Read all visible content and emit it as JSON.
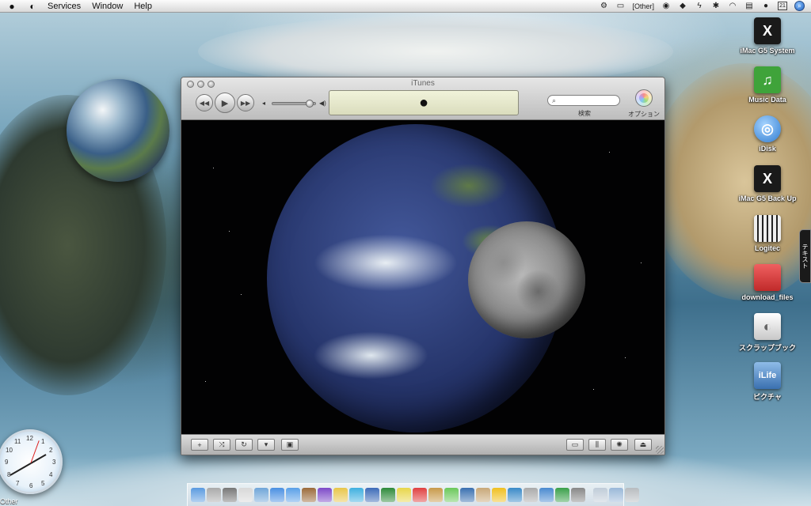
{
  "menubar": {
    "items": [
      "Services",
      "Window",
      "Help"
    ],
    "other_label": "[Other]",
    "calendar_day": "21"
  },
  "itunes": {
    "title": "iTunes",
    "search_label": "検索",
    "options_label": "オプション",
    "volume_level": 0.8
  },
  "desktop_icons": [
    {
      "label": "iMac G5 System",
      "icon": "x-drive-icon",
      "color": "#1a1a1a"
    },
    {
      "label": "Music Data",
      "icon": "music-folder-icon",
      "color": "#3fa33a"
    },
    {
      "label": "iDisk",
      "icon": "idisk-icon",
      "color": "#2f7bd0"
    },
    {
      "label": "iMac G5 Back Up",
      "icon": "x-drive-icon",
      "color": "#1a1a1a"
    },
    {
      "label": "Logitec",
      "icon": "logitec-drive-icon",
      "color": "#222222"
    },
    {
      "label": "download_files",
      "icon": "red-folder-icon",
      "color": "#d63b3b"
    },
    {
      "label": "スクラップブック",
      "icon": "scrapbook-icon",
      "color": "#dcdcdc"
    },
    {
      "label": "ピクチャ",
      "icon": "pictures-folder-icon",
      "color": "#5a8fd0"
    }
  ],
  "drawer_tab": {
    "label": "テキスト"
  },
  "clock": {
    "numbers": [
      "12",
      "3",
      "6",
      "9",
      "1",
      "2",
      "4",
      "5",
      "7",
      "8",
      "10",
      "11"
    ],
    "label": "Other"
  },
  "dock": {
    "items": [
      {
        "icon": "finder-icon",
        "color": "#5b9be0"
      },
      {
        "icon": "mac-icon",
        "color": "#aaaaaa"
      },
      {
        "icon": "calculator-icon",
        "color": "#777777"
      },
      {
        "icon": "ruler-icon",
        "color": "#d8d8d8"
      },
      {
        "icon": "preview-icon",
        "color": "#6fa5d8"
      },
      {
        "icon": "safari-icon",
        "color": "#4a90e2"
      },
      {
        "icon": "ichat-icon",
        "color": "#5aa0e8"
      },
      {
        "icon": "address-icon",
        "color": "#9b6a3a"
      },
      {
        "icon": "pen-icon",
        "color": "#7d4ac8"
      },
      {
        "icon": "folder-icon",
        "color": "#e8c64a"
      },
      {
        "icon": "folder-icon",
        "color": "#3fb0e0"
      },
      {
        "icon": "word-icon",
        "color": "#3d6bb8"
      },
      {
        "icon": "excel-icon",
        "color": "#2e8a3a"
      },
      {
        "icon": "stickies-icon",
        "color": "#e8d64a"
      },
      {
        "icon": "calendar-icon",
        "color": "#e04040"
      },
      {
        "icon": "book-icon",
        "color": "#c89a4a"
      },
      {
        "icon": "itunes-icon",
        "color": "#6ac85a"
      },
      {
        "icon": "iphoto-icon",
        "color": "#3a70b0"
      },
      {
        "icon": "dictionary-icon",
        "color": "#c8a878"
      },
      {
        "icon": "warning-icon",
        "color": "#f0c020"
      },
      {
        "icon": "photo-icon",
        "color": "#3a8ac8"
      },
      {
        "icon": "printer-icon",
        "color": "#aaaaaa"
      },
      {
        "icon": "network-icon",
        "color": "#4a8ad0"
      },
      {
        "icon": "globe-icon",
        "color": "#3aa04a"
      },
      {
        "icon": "system-prefs-icon",
        "color": "#888888"
      },
      {
        "icon": "documents-folder-icon",
        "color": "#c0ccd8"
      },
      {
        "icon": "downloads-folder-icon",
        "color": "#9ab8d8"
      },
      {
        "icon": "trash-icon",
        "color": "#b8bcc0"
      }
    ]
  }
}
